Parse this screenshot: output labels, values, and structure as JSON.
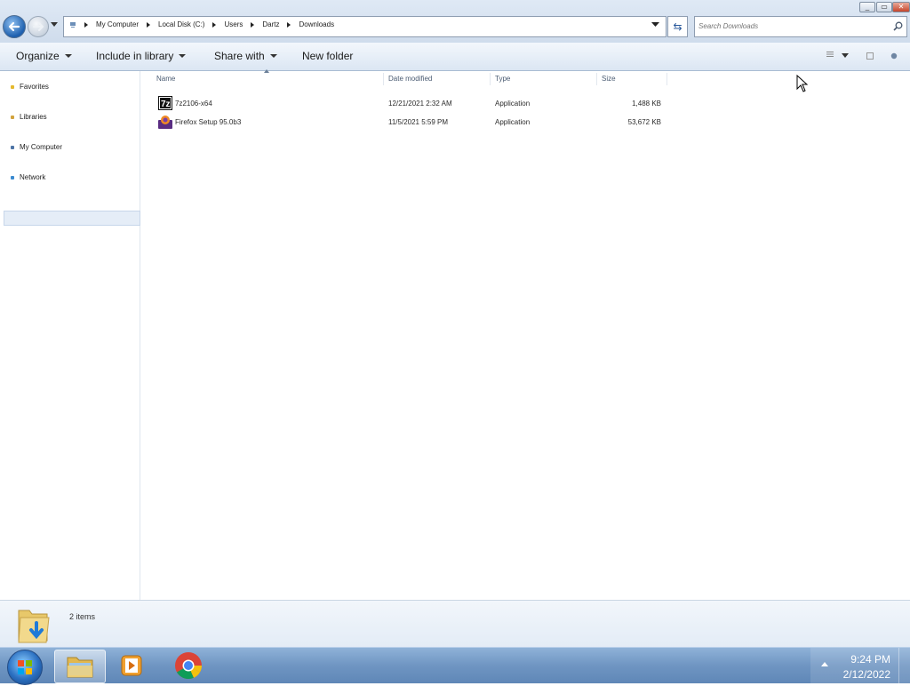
{
  "address": {
    "crumbs": [
      "My Computer",
      "Local Disk (C:)",
      "Users",
      "Dartz",
      "Downloads"
    ]
  },
  "search": {
    "placeholder": "Search Downloads"
  },
  "toolbar": {
    "organize": "Organize",
    "include_in_library": "Include in library",
    "share_with": "Share with",
    "new_folder": "New folder"
  },
  "nav": {
    "favorites": "Favorites",
    "libraries": "Libraries",
    "my_computer": "My Computer",
    "network": "Network"
  },
  "columns": {
    "name": "Name",
    "date_modified": "Date modified",
    "type": "Type",
    "size": "Size"
  },
  "files": [
    {
      "name": "7z2106-x64",
      "date": "12/21/2021 2:32 AM",
      "type": "Application",
      "size": "1,488 KB",
      "icon": "7zip-icon"
    },
    {
      "name": "Firefox Setup 95.0b3",
      "date": "11/5/2021 5:59 PM",
      "type": "Application",
      "size": "53,672 KB",
      "icon": "firefox-installer-icon"
    }
  ],
  "details": {
    "item_count": "2 items"
  },
  "clock": {
    "time": "9:24 PM",
    "date": "2/12/2022"
  },
  "colors": {
    "accent": "#1d5fae",
    "taskbar": "#6f95c2"
  }
}
